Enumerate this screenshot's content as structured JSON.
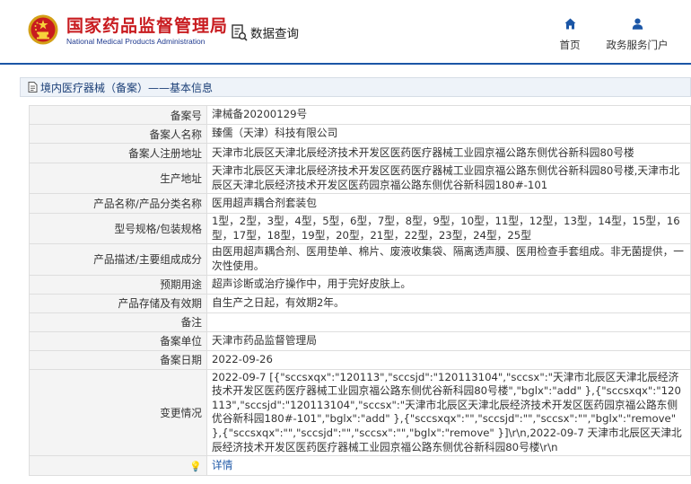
{
  "header": {
    "site_name": "国家药品监督管理局",
    "site_name_en": "National Medical Products Administration",
    "search_label": "数据查询",
    "nav": [
      {
        "label": "首页",
        "icon": "home-icon"
      },
      {
        "label": "政务服务门户",
        "icon": "user-icon"
      }
    ]
  },
  "breadcrumb": "境内医疗器械（备案）——基本信息",
  "colors": {
    "brand_red": "#c81b1f",
    "brand_blue": "#1b56a6",
    "label_bg": "#f4f4f4",
    "border": "#dedede"
  },
  "rows": [
    {
      "label": "备案号",
      "value": "津械备20200129号"
    },
    {
      "label": "备案人名称",
      "value": "臻儒（天津）科技有限公司"
    },
    {
      "label": "备案人注册地址",
      "value": "天津市北辰区天津北辰经济技术开发区医药医疗器械工业园京福公路东侧优谷新科园80号楼"
    },
    {
      "label": "生产地址",
      "value": "天津市北辰区天津北辰经济技术开发区医药医疗器械工业园京福公路东侧优谷新科园80号楼,天津市北辰区天津北辰经济技术开发区医药园京福公路东侧优谷新科园180#-101"
    },
    {
      "label": "产品名称/产品分类名称",
      "value": "医用超声耦合剂套装包"
    },
    {
      "label": "型号规格/包装规格",
      "value": "1型，2型，3型，4型，5型，6型，7型，8型，9型，10型，11型，12型，13型，14型，15型，16型，17型，18型，19型，20型，21型，22型，23型，24型，25型"
    },
    {
      "label": "产品描述/主要组成成分",
      "value": "由医用超声耦合剂、医用垫单、棉片、废液收集袋、隔离透声膜、医用检查手套组成。非无菌提供，一次性使用。"
    },
    {
      "label": "预期用途",
      "value": "超声诊断或治疗操作中，用于完好皮肤上。"
    },
    {
      "label": "产品存储及有效期",
      "value": "自生产之日起，有效期2年。"
    },
    {
      "label": "备注",
      "value": ""
    },
    {
      "label": "备案单位",
      "value": "天津市药品监督管理局"
    },
    {
      "label": "备案日期",
      "value": "2022-09-26"
    },
    {
      "label": "变更情况",
      "value": "2022-09-7 [{\"sccsxqx\":\"120113\",\"sccsjd\":\"120113104\",\"sccsx\":\"天津市北辰区天津北辰经济技术开发区医药医疗器械工业园京福公路东侧优谷新科园80号楼\",\"bglx\":\"add\" },{\"sccsxqx\":\"120113\",\"sccsjd\":\"120113104\",\"sccsx\":\"天津市北辰区天津北辰经济技术开发区医药园京福公路东侧优谷新科园180#-101\",\"bglx\":\"add\" },{\"sccsxqx\":\"\",\"sccsjd\":\"\",\"sccsx\":\"\",\"bglx\":\"remove\" },{\"sccsxqx\":\"\",\"sccsjd\":\"\",\"sccsx\":\"\",\"bglx\":\"remove\" }]\\r\\n,2022-09-7 天津市北辰区天津北辰经济技术开发区医药医疗器械工业园京福公路东侧优谷新科园80号楼\\r\\n"
    }
  ],
  "detail_row": {
    "icon": "lightbulb-icon",
    "link_label": "详情"
  }
}
